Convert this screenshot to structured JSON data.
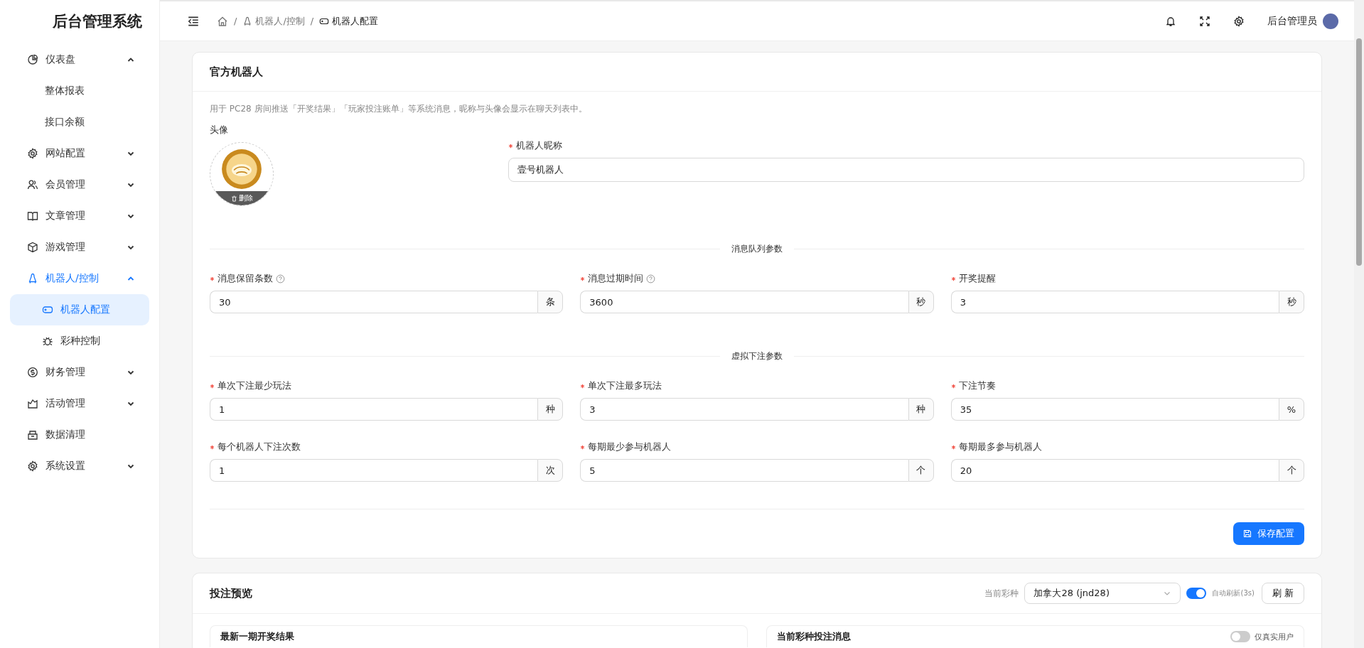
{
  "sidebar": {
    "title": "后台管理系统",
    "items": [
      {
        "label": "仪表盘",
        "expanded": true,
        "selected": false,
        "children": [
          {
            "label": "整体报表",
            "selected": false
          },
          {
            "label": "接口余额",
            "selected": false
          }
        ]
      },
      {
        "label": "网站配置",
        "expanded": false,
        "selected": false
      },
      {
        "label": "会员管理",
        "expanded": false,
        "selected": false
      },
      {
        "label": "文章管理",
        "expanded": false,
        "selected": false
      },
      {
        "label": "游戏管理",
        "expanded": false,
        "selected": false
      },
      {
        "label": "机器人/控制",
        "expanded": true,
        "selected": true,
        "children": [
          {
            "label": "机器人配置",
            "selected": true
          },
          {
            "label": "彩种控制",
            "selected": false
          }
        ]
      },
      {
        "label": "财务管理",
        "expanded": false,
        "selected": false
      },
      {
        "label": "活动管理",
        "expanded": false,
        "selected": false
      },
      {
        "label": "数据清理",
        "selected": false
      },
      {
        "label": "系统设置",
        "expanded": false,
        "selected": false
      }
    ]
  },
  "header": {
    "breadcrumb": [
      {
        "separator": "/",
        "label": "机器人/控制"
      },
      {
        "separator": "/",
        "label": "机器人配置"
      }
    ],
    "user": "后台管理员"
  },
  "robot_card": {
    "title": "官方机器人",
    "description": "用于 PC28 房间推送「开奖结果」「玩家投注账单」等系统消息，昵称与头像会显示在聊天列表中。",
    "avatar_label": "头像",
    "avatar_delete": "删除",
    "nickname": {
      "label": "机器人昵称",
      "required": true,
      "value": "壹号机器人"
    },
    "sections": [
      {
        "title": "消息队列参数",
        "fields": [
          {
            "label": "消息保留条数",
            "required": true,
            "help": true,
            "value": "30",
            "unit": "条"
          },
          {
            "label": "消息过期时间",
            "required": true,
            "help": true,
            "value": "3600",
            "unit": "秒"
          },
          {
            "label": "开奖提醒",
            "required": true,
            "help": false,
            "value": "3",
            "unit": "秒"
          }
        ]
      },
      {
        "title": "虚拟下注参数",
        "fields": [
          {
            "label": "单次下注最少玩法",
            "required": true,
            "help": false,
            "value": "1",
            "unit": "种"
          },
          {
            "label": "单次下注最多玩法",
            "required": true,
            "help": false,
            "value": "3",
            "unit": "种"
          },
          {
            "label": "下注节奏",
            "required": true,
            "help": false,
            "value": "35",
            "unit": "%"
          },
          {
            "label": "每个机器人下注次数",
            "required": true,
            "help": false,
            "value": "1",
            "unit": "次"
          },
          {
            "label": "每期最少参与机器人",
            "required": true,
            "help": false,
            "value": "5",
            "unit": "个"
          },
          {
            "label": "每期最多参与机器人",
            "required": true,
            "help": false,
            "value": "20",
            "unit": "个"
          }
        ]
      }
    ],
    "save_button": "保存配置"
  },
  "preview_card": {
    "title": "投注预览",
    "lottery_label": "当前彩种",
    "lottery_value": "加拿大28 (jnd28)",
    "auto_refresh": {
      "label": "自动刷新(3s)",
      "on": true
    },
    "refresh_button": "刷 新",
    "panels": [
      {
        "title": "最新一期开奖结果"
      },
      {
        "title": "当前彩种投注消息",
        "toggle": {
          "label": "仅真实用户",
          "on": false
        }
      }
    ]
  }
}
